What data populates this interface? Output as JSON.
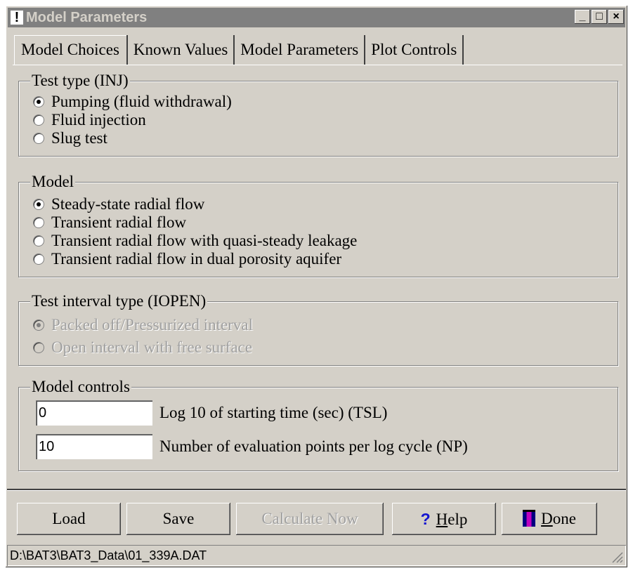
{
  "window": {
    "title": "Model Parameters",
    "controls": [
      "_",
      "□",
      "×"
    ]
  },
  "tabs": [
    {
      "label": "Model Choices",
      "active": true
    },
    {
      "label": "Known Values"
    },
    {
      "label": "Model Parameters"
    },
    {
      "label": "Plot Controls"
    }
  ],
  "test_type": {
    "legend": "Test type (INJ)",
    "options": [
      "Pumping (fluid withdrawal)",
      "Fluid injection",
      "Slug test"
    ],
    "selected": "Pumping (fluid withdrawal)"
  },
  "model": {
    "legend": "Model",
    "options": [
      "Steady-state radial flow",
      "Transient radial flow",
      "Transient radial flow with quasi-steady leakage",
      "Transient radial flow in dual porosity aquifer"
    ],
    "selected": "Steady-state radial flow"
  },
  "interval": {
    "legend": "Test interval type (IOPEN)",
    "options": [
      "Packed off/Pressurized interval",
      "Open interval with free surface"
    ],
    "selected": "Packed off/Pressurized interval"
  },
  "controls": {
    "legend": "Model controls",
    "tsl_value": "0",
    "tsl_label": "Log 10 of starting time (sec) (TSL)",
    "np_value": "10",
    "np_label": "Number of evaluation points per log cycle (NP)"
  },
  "buttons": {
    "load": "Load",
    "save": "Save",
    "calculate": "Calculate Now",
    "help_mnemonic": "H",
    "help_rest": "elp",
    "done_mnemonic": "D",
    "done_rest": "one"
  },
  "status": {
    "path": "D:\\BAT3\\BAT3_Data\\01_339A.DAT"
  },
  "colors": {
    "face": "#d4d0c8",
    "title_inactive": "#808080",
    "help_icon": "#1515d0"
  }
}
